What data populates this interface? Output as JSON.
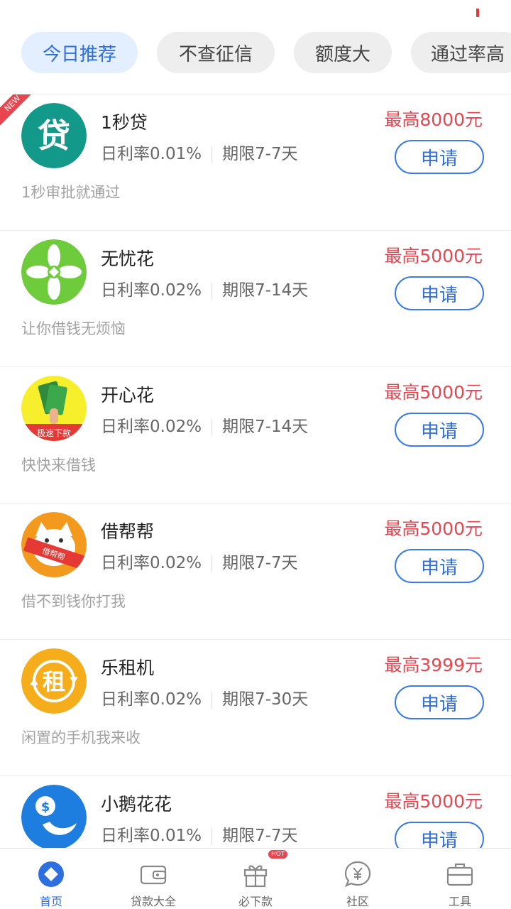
{
  "filters": [
    "今日推荐",
    "不查征信",
    "额度大",
    "通过率高"
  ],
  "products": [
    {
      "name": "1秒贷",
      "rate": "日利率0.01%",
      "term": "期限7-7天",
      "desc": "1秒审批就通过",
      "amount": "最高8000元",
      "logo_text": "贷",
      "badge": "NEW"
    },
    {
      "name": "无忧花",
      "rate": "日利率0.02%",
      "term": "期限7-14天",
      "desc": "让你借钱无烦恼",
      "amount": "最高5000元"
    },
    {
      "name": "开心花",
      "rate": "日利率0.02%",
      "term": "期限7-14天",
      "desc": "快快来借钱",
      "amount": "最高5000元",
      "logo_text": "极速下款"
    },
    {
      "name": "借帮帮",
      "rate": "日利率0.02%",
      "term": "期限7-7天",
      "desc": "借不到钱你打我",
      "amount": "最高5000元",
      "logo_text": "借帮帮"
    },
    {
      "name": "乐租机",
      "rate": "日利率0.02%",
      "term": "期限7-30天",
      "desc": "闲置的手机我来收",
      "amount": "最高3999元",
      "logo_text": "租"
    },
    {
      "name": "小鹅花花",
      "rate": "日利率0.01%",
      "term": "期限7-7天",
      "desc": "",
      "amount": "最高5000元",
      "logo_text": "$"
    }
  ],
  "apply_label": "申请",
  "tabs": [
    {
      "label": "首页",
      "icon": "home-diamond-icon"
    },
    {
      "label": "贷款大全",
      "icon": "wallet-icon"
    },
    {
      "label": "必下款",
      "icon": "gift-icon",
      "badge": "HOT"
    },
    {
      "label": "社区",
      "icon": "yen-chat-icon"
    },
    {
      "label": "工具",
      "icon": "briefcase-icon"
    }
  ],
  "colors": {
    "accent": "#2e6fe0",
    "amount_red": "#e8454f",
    "chip_active_bg": "#e3efff"
  }
}
